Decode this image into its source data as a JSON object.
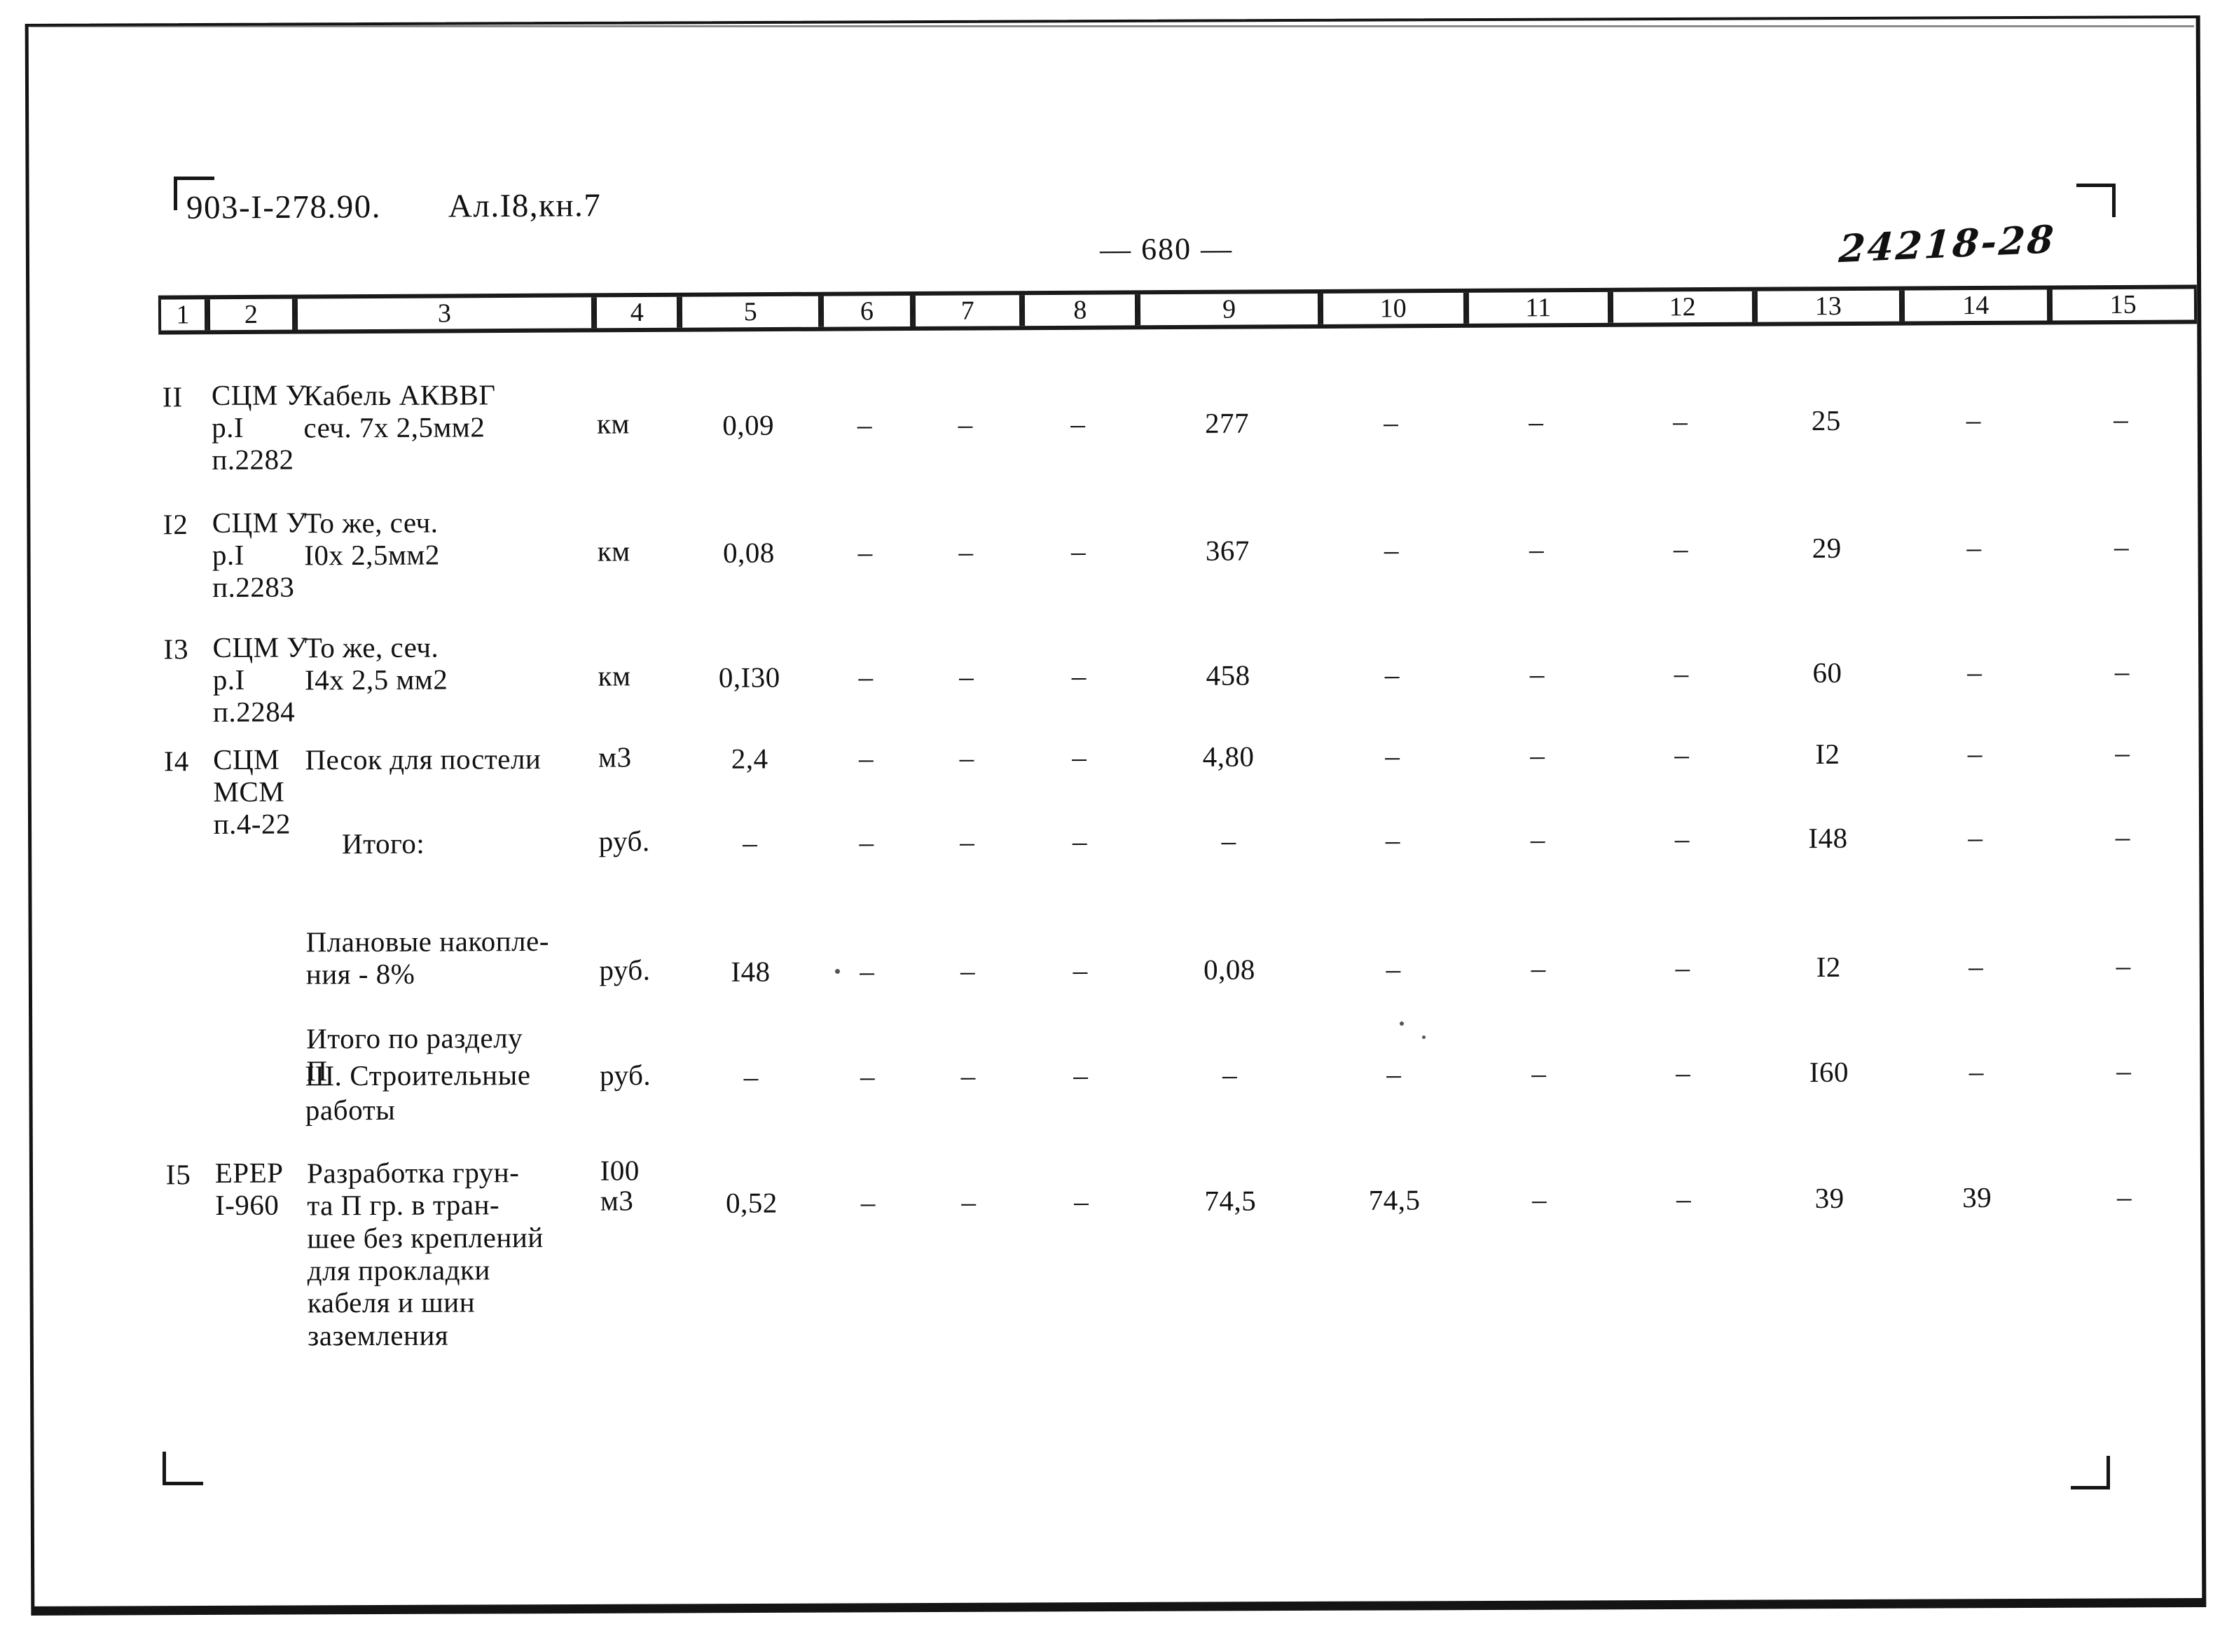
{
  "header": {
    "doc_code": "903-I-278.90.",
    "album": "Ал.I8,кн.7",
    "page_number": "— 680 —",
    "archive_stamp": "24218-28"
  },
  "table": {
    "column_headers": [
      "1",
      "2",
      "3",
      "4",
      "5",
      "6",
      "7",
      "8",
      "9",
      "10",
      "11",
      "12",
      "13",
      "14",
      "15"
    ],
    "rows": [
      {
        "pos": "II",
        "code": "СЦМ У\nр.I\nп.2282",
        "name": "Кабель АКВВГ\nсеч. 7х 2,5мм2",
        "unit": "км",
        "c5": "0,09",
        "c6": "–",
        "c7": "–",
        "c8": "–",
        "c9": "277",
        "c10": "–",
        "c11": "–",
        "c12": "–",
        "c13": "25",
        "c14": "–",
        "c15": "–"
      },
      {
        "pos": "I2",
        "code": "СЦМ У\nр.I\nп.2283",
        "name": "То же, сеч.\nI0х 2,5мм2",
        "unit": "км",
        "c5": "0,08",
        "c6": "–",
        "c7": "–",
        "c8": "–",
        "c9": "367",
        "c10": "–",
        "c11": "–",
        "c12": "–",
        "c13": "29",
        "c14": "–",
        "c15": "–"
      },
      {
        "pos": "I3",
        "code": "СЦМ У\nр.I\nп.2284",
        "name": "То же, сеч.\nI4х 2,5 мм2",
        "unit": "км",
        "c5": "0,I30",
        "c6": "–",
        "c7": "–",
        "c8": "–",
        "c9": "458",
        "c10": "–",
        "c11": "–",
        "c12": "–",
        "c13": "60",
        "c14": "–",
        "c15": "–"
      },
      {
        "pos": "I4",
        "code": "СЦМ\nМСМ\nп.4-22",
        "name": "Песок для постели",
        "unit": "м3",
        "c5": "2,4",
        "c6": "–",
        "c7": "–",
        "c8": "–",
        "c9": "4,80",
        "c10": "–",
        "c11": "–",
        "c12": "–",
        "c13": "I2",
        "c14": "–",
        "c15": "–"
      },
      {
        "pos": "",
        "code": "",
        "name": "Итого:",
        "unit": "руб.",
        "c5": "–",
        "c6": "–",
        "c7": "–",
        "c8": "–",
        "c9": "–",
        "c10": "–",
        "c11": "–",
        "c12": "–",
        "c13": "I48",
        "c14": "–",
        "c15": "–"
      },
      {
        "pos": "",
        "code": "",
        "name": "Плановые накопле-\nния - 8%",
        "unit": "руб.",
        "c5": "I48",
        "c6": "–",
        "c7": "–",
        "c8": "–",
        "c9": "0,08",
        "c10": "–",
        "c11": "–",
        "c12": "–",
        "c13": "I2",
        "c14": "–",
        "c15": "–"
      },
      {
        "pos": "",
        "code": "",
        "name": "Итого по разделу\n           П",
        "unit": "руб.",
        "c5": "–",
        "c6": "–",
        "c7": "–",
        "c8": "–",
        "c9": "–",
        "c10": "–",
        "c11": "–",
        "c12": "–",
        "c13": "I60",
        "c14": "–",
        "c15": "–"
      },
      {
        "pos": "I5",
        "code": "ЕРЕР\nI-960",
        "name": "Разработка грун-\nта П гр. в тран-\nшее без креплений\nдля прокладки\nкабеля и шин\nзаземления",
        "unit": "I00\nм3",
        "c5": "0,52",
        "c6": "–",
        "c7": "–",
        "c8": "–",
        "c9": "74,5",
        "c10": "74,5",
        "c11": "–",
        "c12": "–",
        "c13": "39",
        "c14": "39",
        "c15": "–"
      }
    ],
    "section_heading": "Ш. Строительные\n       работы"
  }
}
